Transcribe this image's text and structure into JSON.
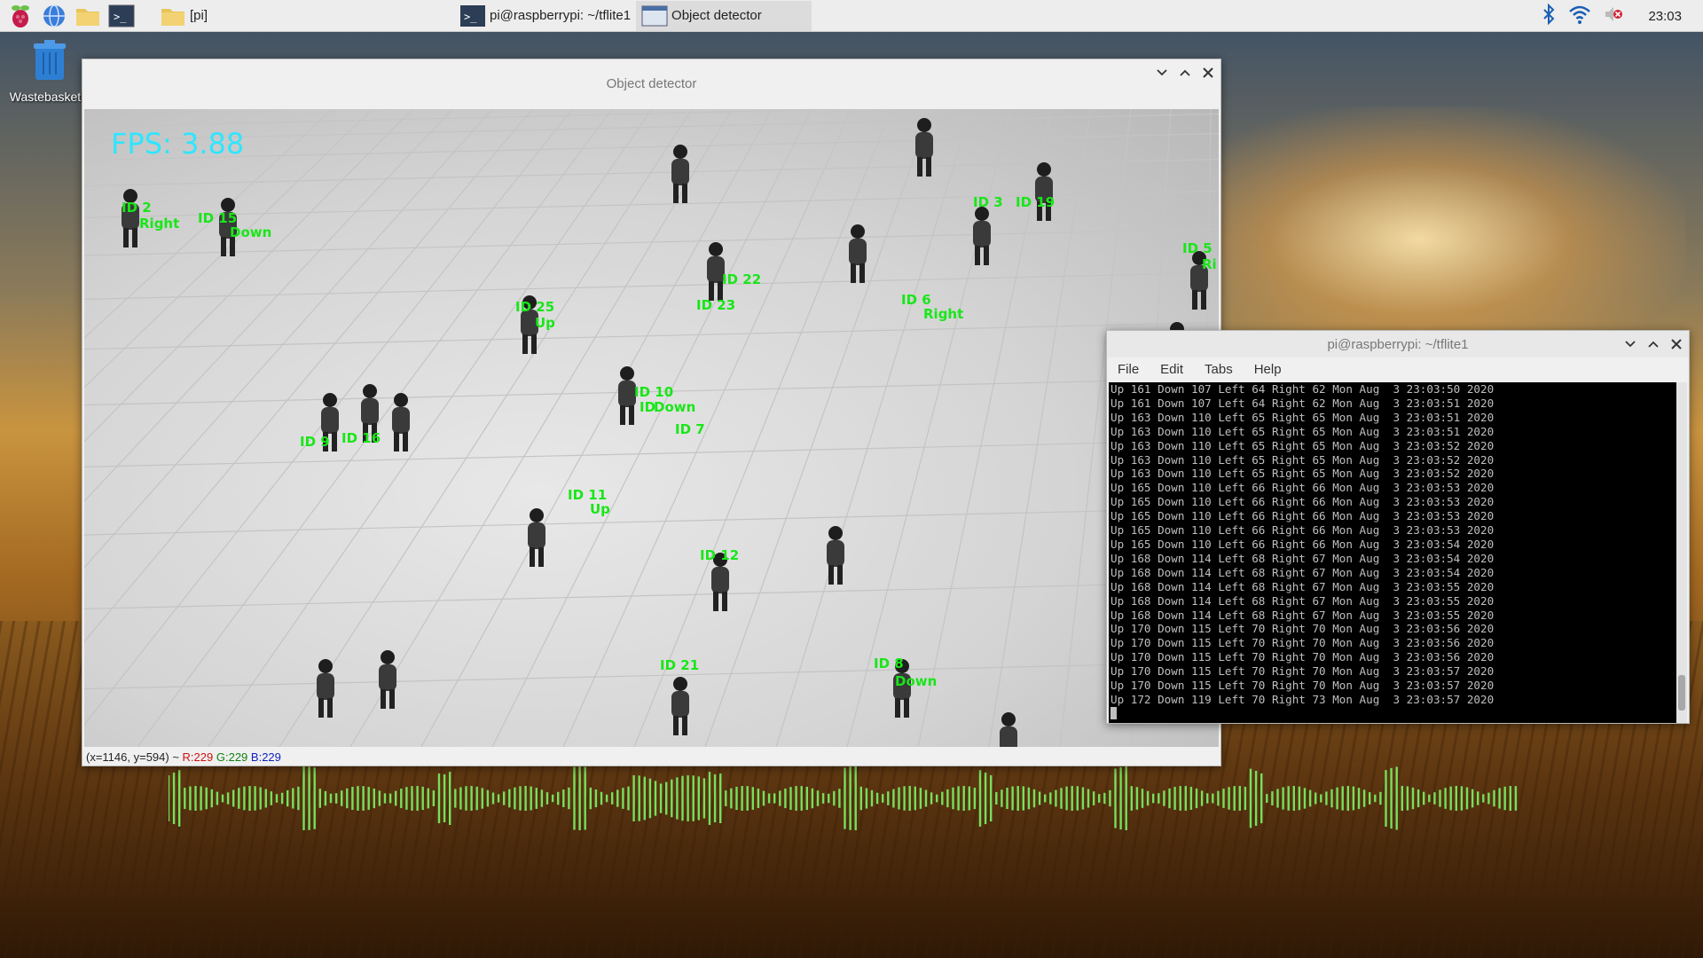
{
  "taskbar": {
    "tasks": [
      {
        "label": "[pi]"
      },
      {
        "label": "pi@raspberrypi: ~/tflite1"
      },
      {
        "label": "Object detector"
      }
    ],
    "clock": "23:03"
  },
  "desktop": {
    "trash_label": "Wastebasket"
  },
  "detector": {
    "title": "Object detector",
    "fps": "FPS:  3.88",
    "labels": [
      {
        "text": "ID 2"
      },
      {
        "text": "Right"
      },
      {
        "text": "ID 15"
      },
      {
        "text": "Down"
      },
      {
        "text": "ID 25"
      },
      {
        "text": "Up"
      },
      {
        "text": "ID 9"
      },
      {
        "text": "ID 16"
      },
      {
        "text": "ID 10"
      },
      {
        "text": "ID"
      },
      {
        "text": "Down"
      },
      {
        "text": "ID 7"
      },
      {
        "text": "ID 22"
      },
      {
        "text": "ID 23"
      },
      {
        "text": "ID 3"
      },
      {
        "text": "ID 19"
      },
      {
        "text": "ID 6"
      },
      {
        "text": "Right"
      },
      {
        "text": "ID 5"
      },
      {
        "text": "Ri"
      },
      {
        "text": "ID 11"
      },
      {
        "text": "Up"
      },
      {
        "text": "ID 12"
      },
      {
        "text": "ID 21"
      },
      {
        "text": "ID 8"
      },
      {
        "text": "Down"
      }
    ],
    "status": {
      "prefix": "(x=1146, y=594) ~ ",
      "r": "R:229",
      "g": "G:229",
      "b": "B:229"
    }
  },
  "terminal": {
    "title": "pi@raspberrypi: ~/tflite1",
    "menu": [
      "File",
      "Edit",
      "Tabs",
      "Help"
    ],
    "lines": [
      "Up 161 Down 107 Left 64 Right 62 Mon Aug  3 23:03:50 2020",
      "Up 161 Down 107 Left 64 Right 62 Mon Aug  3 23:03:51 2020",
      "Up 163 Down 110 Left 65 Right 65 Mon Aug  3 23:03:51 2020",
      "Up 163 Down 110 Left 65 Right 65 Mon Aug  3 23:03:51 2020",
      "Up 163 Down 110 Left 65 Right 65 Mon Aug  3 23:03:52 2020",
      "Up 163 Down 110 Left 65 Right 65 Mon Aug  3 23:03:52 2020",
      "Up 163 Down 110 Left 65 Right 65 Mon Aug  3 23:03:52 2020",
      "Up 165 Down 110 Left 66 Right 66 Mon Aug  3 23:03:53 2020",
      "Up 165 Down 110 Left 66 Right 66 Mon Aug  3 23:03:53 2020",
      "Up 165 Down 110 Left 66 Right 66 Mon Aug  3 23:03:53 2020",
      "Up 165 Down 110 Left 66 Right 66 Mon Aug  3 23:03:53 2020",
      "Up 165 Down 110 Left 66 Right 66 Mon Aug  3 23:03:54 2020",
      "Up 168 Down 114 Left 68 Right 67 Mon Aug  3 23:03:54 2020",
      "Up 168 Down 114 Left 68 Right 67 Mon Aug  3 23:03:54 2020",
      "Up 168 Down 114 Left 68 Right 67 Mon Aug  3 23:03:55 2020",
      "Up 168 Down 114 Left 68 Right 67 Mon Aug  3 23:03:55 2020",
      "Up 168 Down 114 Left 68 Right 67 Mon Aug  3 23:03:55 2020",
      "Up 170 Down 115 Left 70 Right 70 Mon Aug  3 23:03:56 2020",
      "Up 170 Down 115 Left 70 Right 70 Mon Aug  3 23:03:56 2020",
      "Up 170 Down 115 Left 70 Right 70 Mon Aug  3 23:03:56 2020",
      "Up 170 Down 115 Left 70 Right 70 Mon Aug  3 23:03:57 2020",
      "Up 170 Down 115 Left 70 Right 70 Mon Aug  3 23:03:57 2020",
      "Up 172 Down 119 Left 70 Right 73 Mon Aug  3 23:03:57 2020"
    ]
  }
}
